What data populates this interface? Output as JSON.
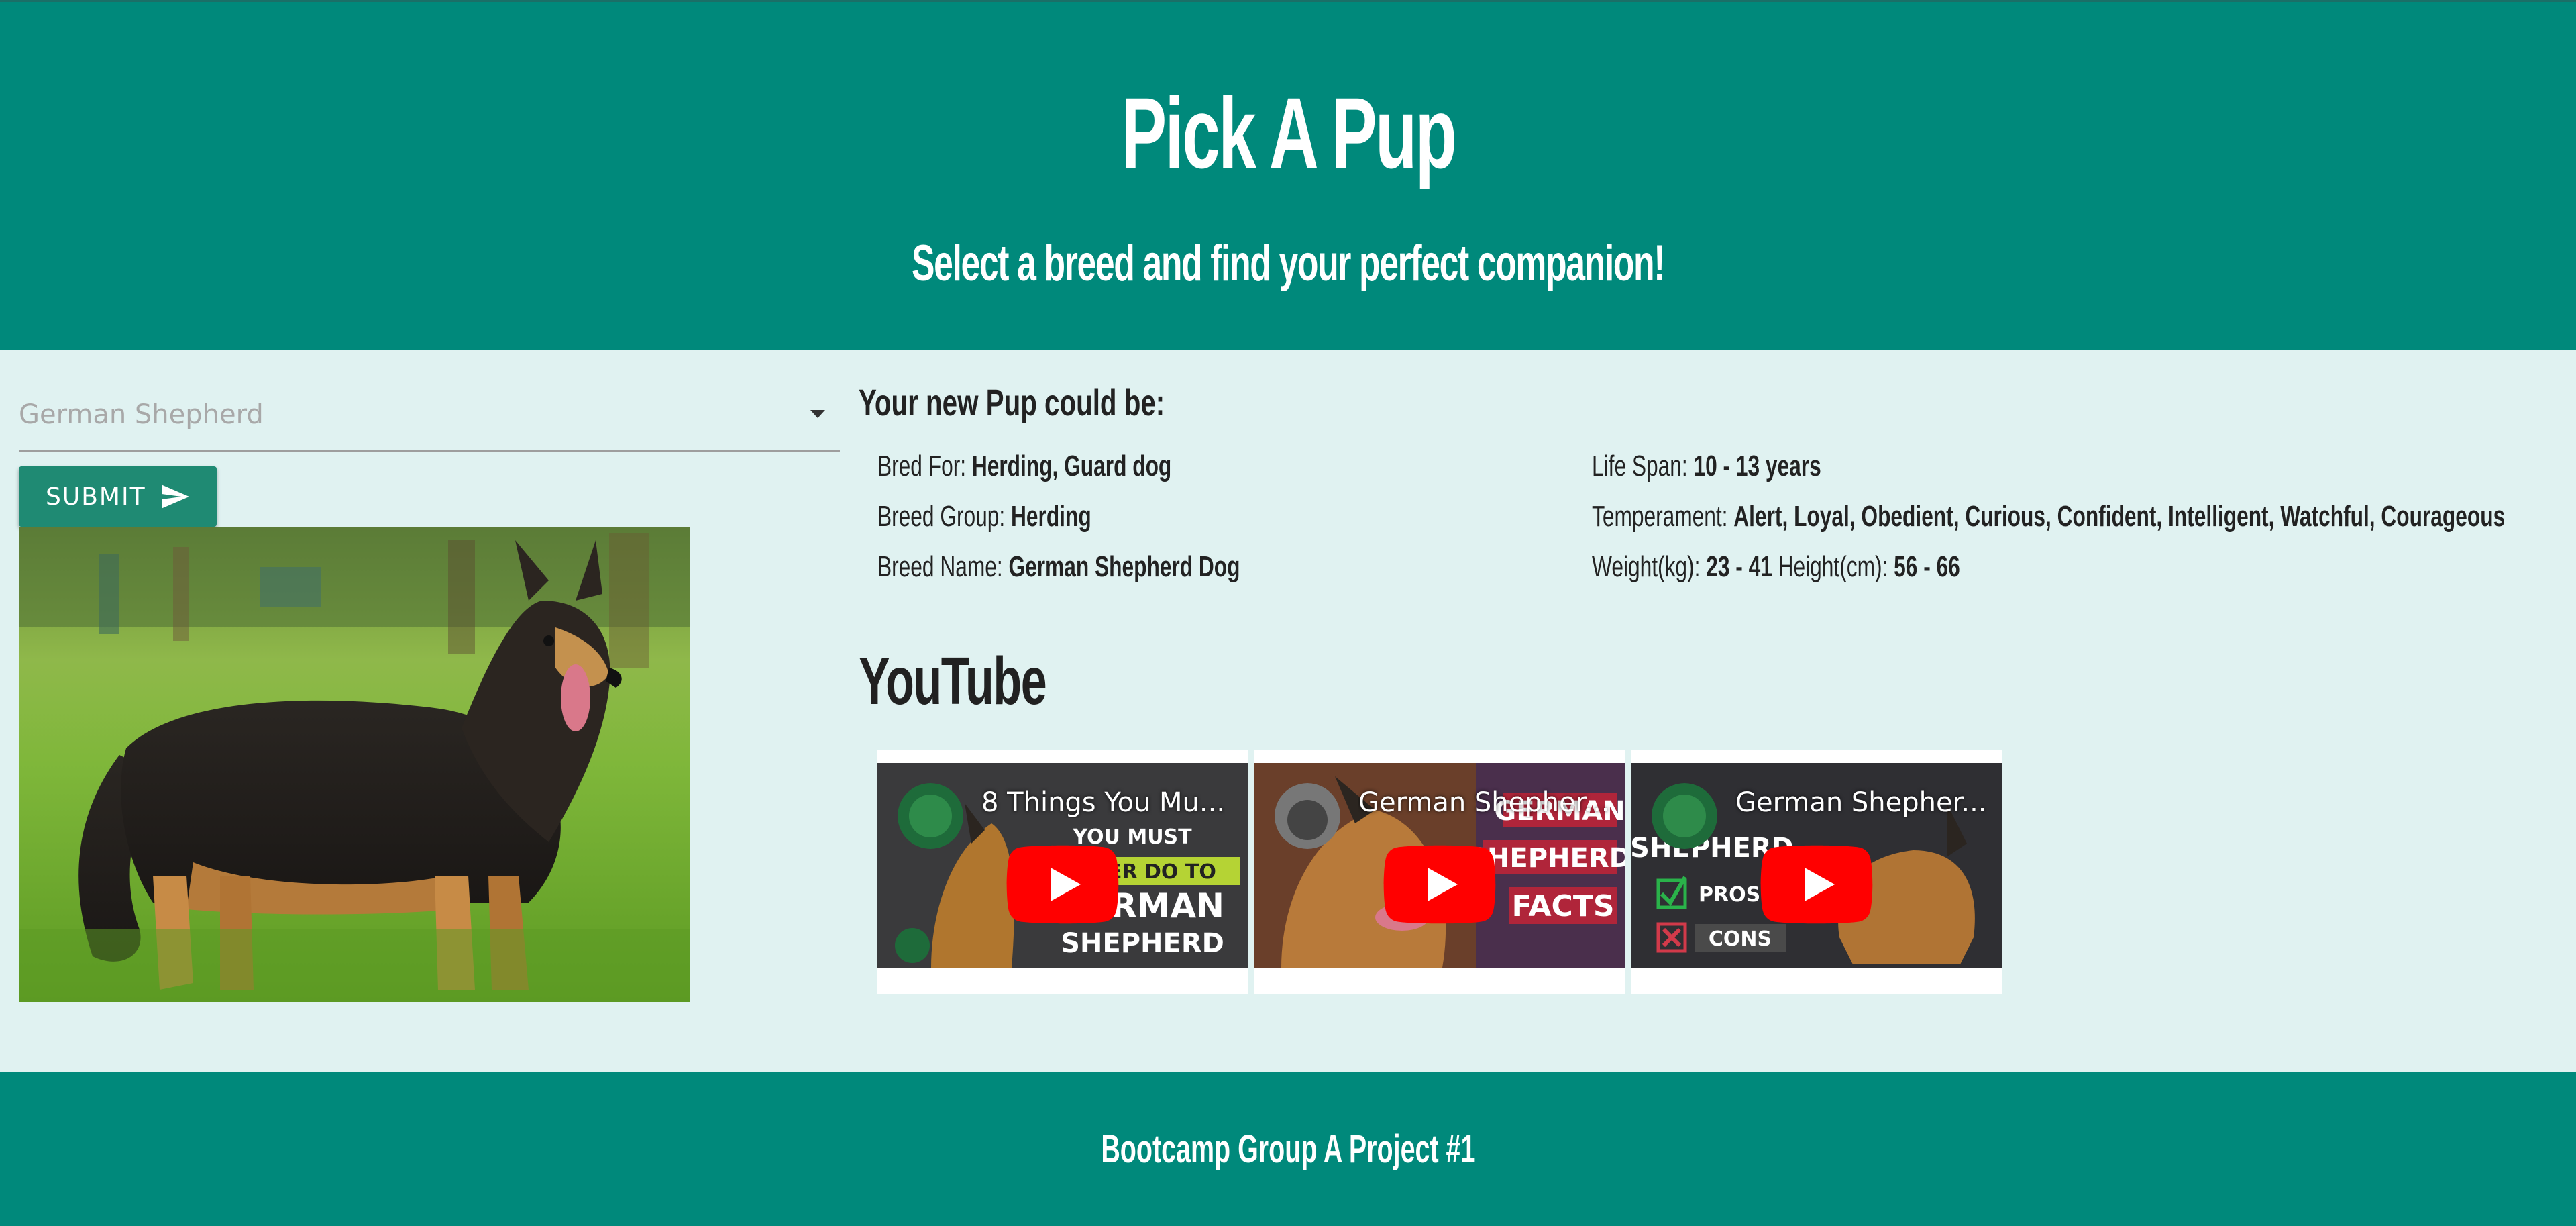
{
  "header": {
    "title": "Pick A Pup",
    "subtitle": "Select a breed and find your perfect companion!"
  },
  "breed_select": {
    "selected": "German Shepherd"
  },
  "submit": {
    "label": "SUBMIT"
  },
  "info": {
    "heading": "Your new Pup could be:",
    "bred_for_label": "Bred For:",
    "bred_for": "Herding, Guard dog",
    "breed_group_label": "Breed Group:",
    "breed_group": "Herding",
    "breed_name_label": "Breed Name:",
    "breed_name": "German Shepherd Dog",
    "life_span_label": "Life Span:",
    "life_span": "10 - 13 years",
    "temperament_label": "Temperament:",
    "temperament": "Alert, Loyal, Obedient, Curious, Confident, Intelligent, Watchful, Courageous",
    "weight_label": "Weight(kg):",
    "weight": "23 - 41",
    "height_label": "Height(cm):",
    "height": "56 - 66"
  },
  "youtube": {
    "heading": "YouTube",
    "videos": [
      {
        "title": "8 Things You Mu...",
        "thumb_text_1": "8 THINGS",
        "thumb_text_2": "YOU MUST",
        "thumb_text_3": "NEVER DO TO",
        "thumb_text_4": "GERMAN",
        "thumb_text_5": "SHEPHERD"
      },
      {
        "title": "German Shepher...",
        "thumb_text_1": "GERMAN",
        "thumb_text_2": "SHEPHERD",
        "thumb_text_3": "FACTS"
      },
      {
        "title": "German Shepher...",
        "thumb_text_1": "GERMAN",
        "thumb_text_2": "SHEPHERD",
        "thumb_text_3": "PROS",
        "thumb_text_4": "CONS"
      }
    ]
  },
  "footer": {
    "text": "Bootcamp Group A Project #1"
  },
  "colors": {
    "primary": "#00897b",
    "background": "#e0f2f1",
    "button": "#1f8a73",
    "youtube_red": "#ff0000"
  }
}
